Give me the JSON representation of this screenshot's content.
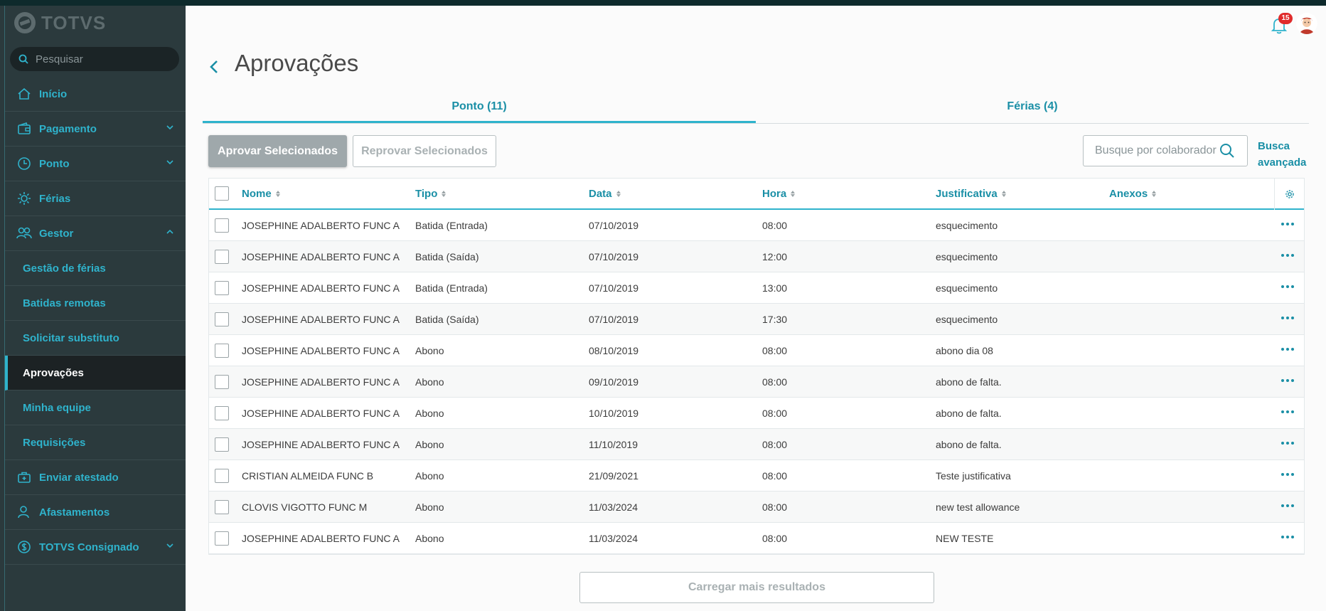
{
  "brand": {
    "name": "TOTVS"
  },
  "search": {
    "placeholder": "Pesquisar"
  },
  "nav": {
    "items": [
      {
        "label": "Início",
        "icon": "home-icon"
      },
      {
        "label": "Pagamento",
        "icon": "wallet-icon"
      },
      {
        "label": "Ponto",
        "icon": "clock-icon"
      },
      {
        "label": "Férias",
        "icon": "sun-icon"
      },
      {
        "label": "Gestor",
        "icon": "people-icon"
      }
    ],
    "sub_items": [
      {
        "label": "Gestão de férias"
      },
      {
        "label": "Batidas remotas"
      },
      {
        "label": "Solicitar substituto"
      },
      {
        "label": "Aprovações"
      },
      {
        "label": "Minha equipe"
      },
      {
        "label": "Requisições"
      }
    ],
    "bottom_items": [
      {
        "label": "Enviar atestado",
        "icon": "medical-bag-icon"
      },
      {
        "label": "Afastamentos",
        "icon": "person-icon"
      },
      {
        "label": "TOTVS Consignado",
        "icon": "dollar-circle-icon"
      }
    ]
  },
  "header": {
    "notification_count": "15"
  },
  "page": {
    "title": "Aprovações"
  },
  "tabs": [
    {
      "label": "Ponto (11)"
    },
    {
      "label": "Férias (4)"
    }
  ],
  "toolbar": {
    "approve_label": "Aprovar Selecionados",
    "reject_label": "Reprovar Selecionados",
    "search_placeholder": "Busque por colaborador",
    "advanced_line1": "Busca",
    "advanced_line2": "avançada"
  },
  "table": {
    "headers": {
      "nome": "Nome",
      "tipo": "Tipo",
      "data": "Data",
      "hora": "Hora",
      "justificativa": "Justificativa",
      "anexos": "Anexos"
    },
    "rows": [
      {
        "nome": "JOSEPHINE ADALBERTO FUNC A",
        "tipo": "Batida (Entrada)",
        "data": "07/10/2019",
        "hora": "08:00",
        "justificativa": "esquecimento"
      },
      {
        "nome": "JOSEPHINE ADALBERTO FUNC A",
        "tipo": "Batida (Saída)",
        "data": "07/10/2019",
        "hora": "12:00",
        "justificativa": "esquecimento"
      },
      {
        "nome": "JOSEPHINE ADALBERTO FUNC A",
        "tipo": "Batida (Entrada)",
        "data": "07/10/2019",
        "hora": "13:00",
        "justificativa": "esquecimento"
      },
      {
        "nome": "JOSEPHINE ADALBERTO FUNC A",
        "tipo": "Batida (Saída)",
        "data": "07/10/2019",
        "hora": "17:30",
        "justificativa": "esquecimento"
      },
      {
        "nome": "JOSEPHINE ADALBERTO FUNC A",
        "tipo": "Abono",
        "data": "08/10/2019",
        "hora": "08:00",
        "justificativa": "abono dia 08"
      },
      {
        "nome": "JOSEPHINE ADALBERTO FUNC A",
        "tipo": "Abono",
        "data": "09/10/2019",
        "hora": "08:00",
        "justificativa": "abono de falta."
      },
      {
        "nome": "JOSEPHINE ADALBERTO FUNC A",
        "tipo": "Abono",
        "data": "10/10/2019",
        "hora": "08:00",
        "justificativa": "abono de falta."
      },
      {
        "nome": "JOSEPHINE ADALBERTO FUNC A",
        "tipo": "Abono",
        "data": "11/10/2019",
        "hora": "08:00",
        "justificativa": "abono de falta."
      },
      {
        "nome": "CRISTIAN ALMEIDA FUNC B",
        "tipo": "Abono",
        "data": "21/09/2021",
        "hora": "08:00",
        "justificativa": "Teste justificativa"
      },
      {
        "nome": "CLOVIS VIGOTTO FUNC M",
        "tipo": "Abono",
        "data": "11/03/2024",
        "hora": "08:00",
        "justificativa": "new test allowance"
      },
      {
        "nome": "JOSEPHINE ADALBERTO FUNC A",
        "tipo": "Abono",
        "data": "11/03/2024",
        "hora": "08:00",
        "justificativa": "NEW TESTE"
      }
    ]
  },
  "load_more": {
    "label": "Carregar mais resultados"
  },
  "colors": {
    "accent": "#2fb3cc",
    "link": "#1a8fa6",
    "sidebar_bg": "#2b3a3d",
    "badge": "#e02b2b"
  }
}
